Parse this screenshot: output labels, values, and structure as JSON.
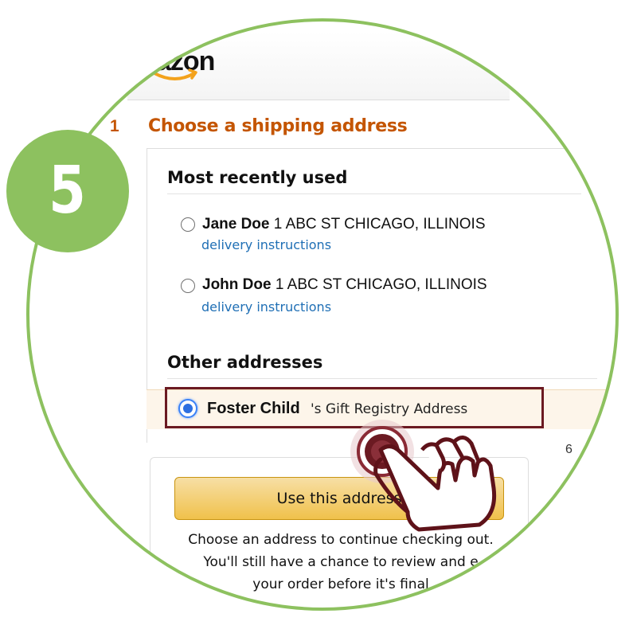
{
  "step_badge": {
    "number": "5",
    "color": "#8dc15f"
  },
  "header": {
    "logo_text": "azon"
  },
  "checkout": {
    "step_number": "1",
    "step_title": "Choose a shipping address",
    "recent_heading": "Most recently used",
    "recent_addresses": [
      {
        "name": "Jane Doe",
        "address": "1 ABC ST CHICAGO, ILLINOIS",
        "link": "delivery instructions",
        "selected": false
      },
      {
        "name": "John Doe",
        "address": "1 ABC ST CHICAGO, ILLINOIS",
        "link": "delivery instructions",
        "selected": false
      }
    ],
    "other_heading": "Other addresses",
    "other_address": {
      "name": "Foster Child",
      "suffix": "'s Gift Registry Address",
      "selected": true
    },
    "truncated_text": "6",
    "use_address_button": "Use this address",
    "help_text_lines": [
      "Choose an address to continue checking out.",
      "You'll still have a chance to review and e",
      "your order before it's final"
    ]
  },
  "colors": {
    "accent_orange": "#c45500",
    "link_blue": "#1f6fb5",
    "highlight_frame": "#6b1a22",
    "button_yellow": "#f0c14b",
    "ring_green": "#8dc15f"
  },
  "icons": [
    "amazon-smile-icon",
    "tap-hand-icon"
  ]
}
